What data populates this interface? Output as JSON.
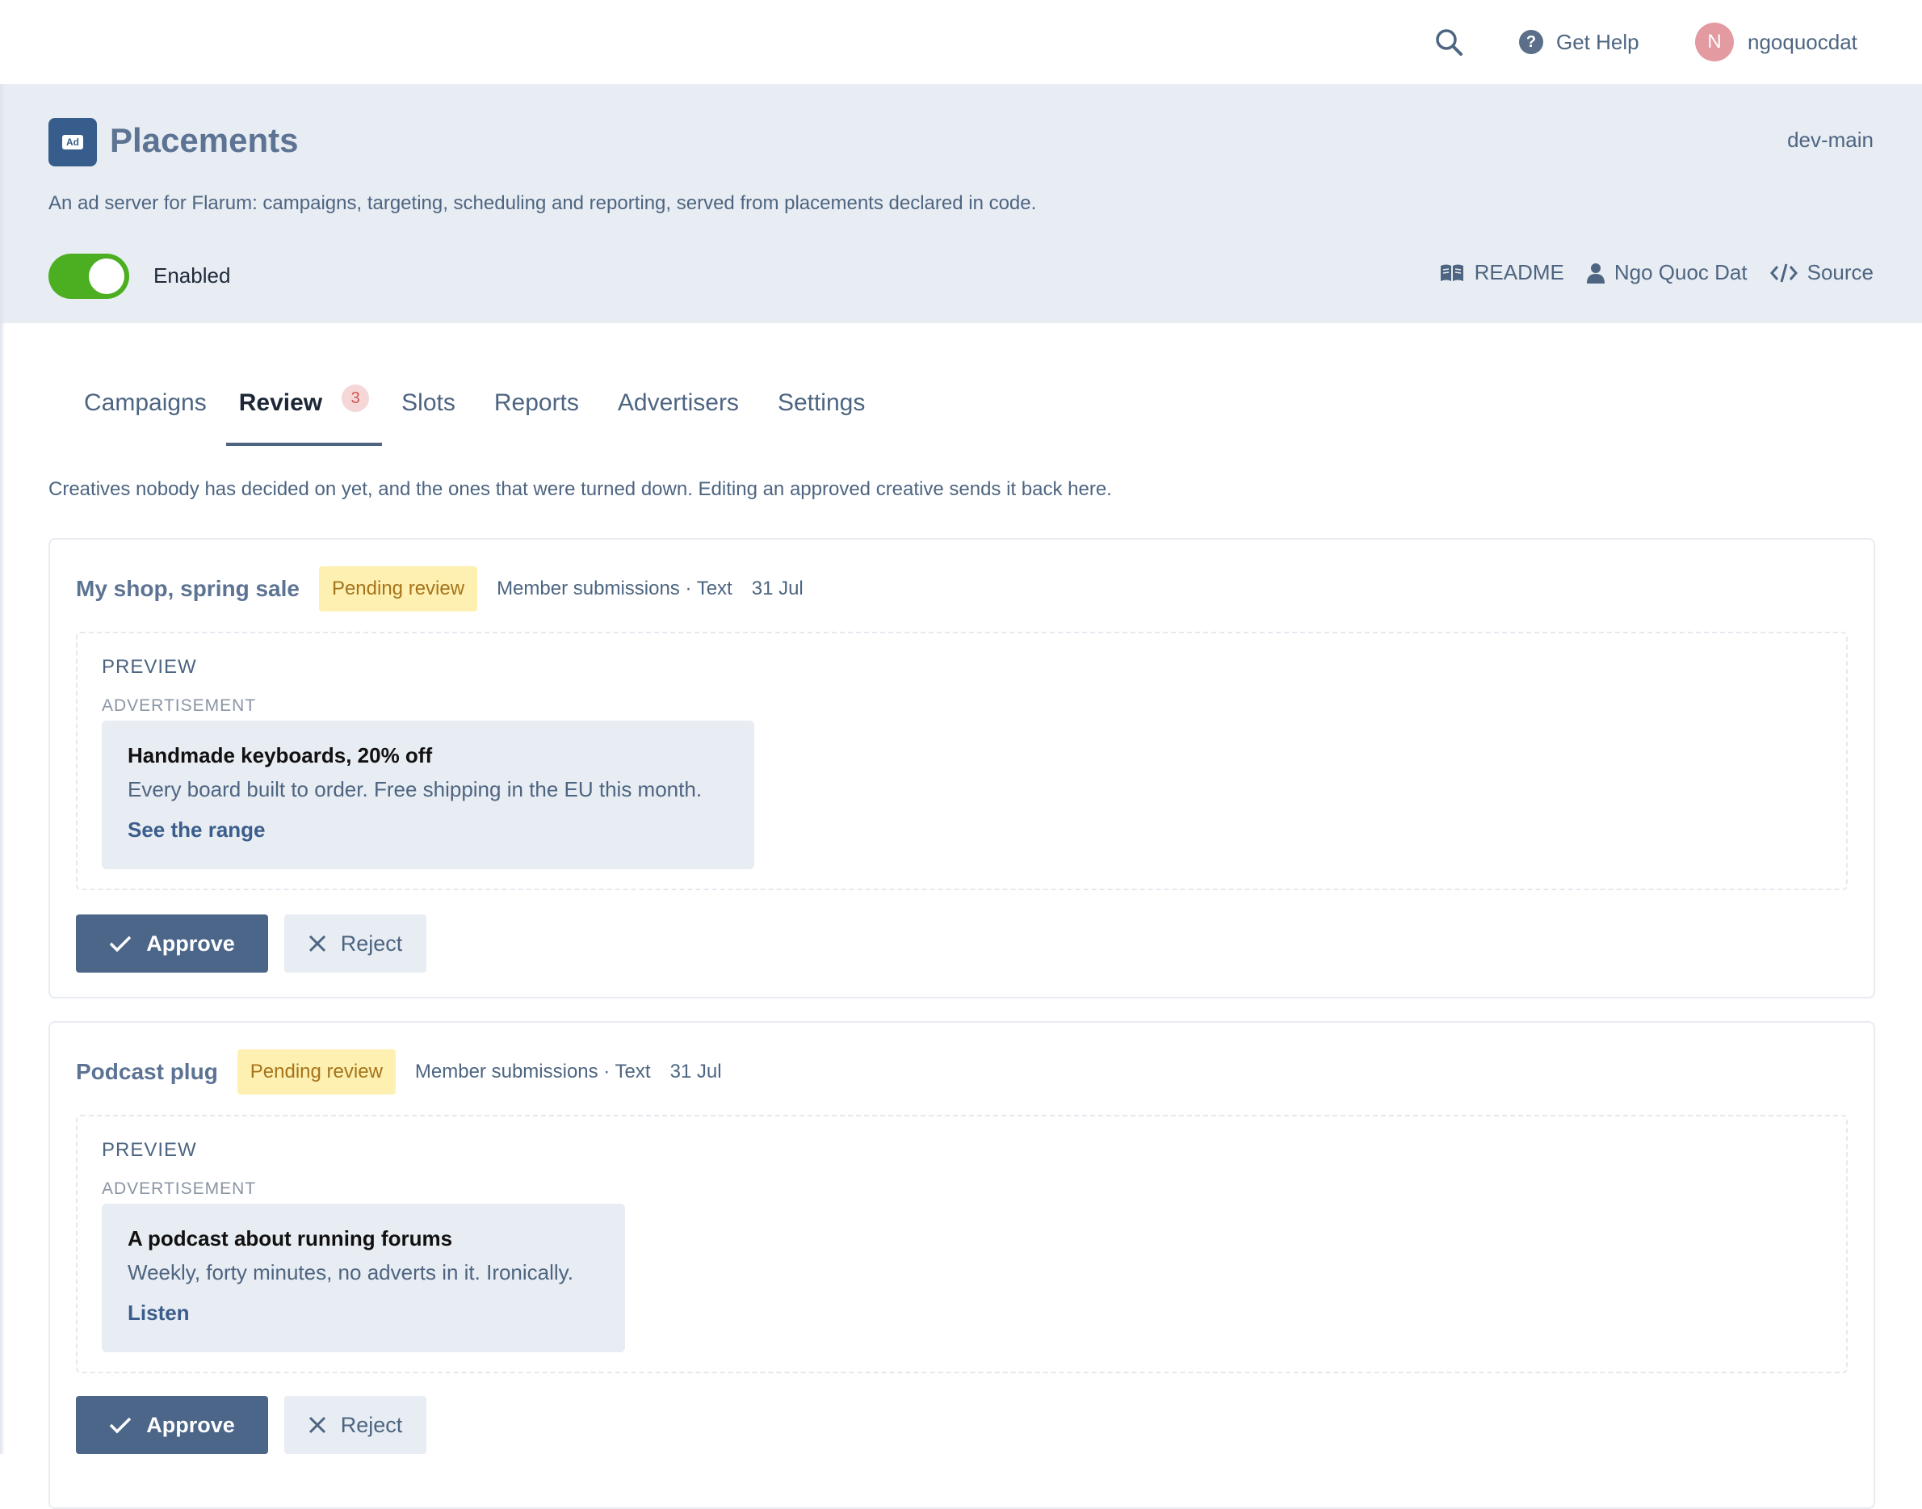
{
  "topbar": {
    "search_icon": "search-icon",
    "help_label": "Get Help",
    "help_icon": "question-circle-icon",
    "avatar_initial": "N",
    "username": "ngoquocdat"
  },
  "extension": {
    "title": "Placements",
    "icon_text": "Ad",
    "version": "dev-main",
    "description": "An ad server for Flarum: campaigns, targeting, scheduling and reporting, served from placements declared in code.",
    "enabled_label": "Enabled",
    "enabled": true,
    "links": {
      "readme": "README",
      "author": "Ngo Quoc Dat",
      "source": "Source"
    }
  },
  "tabs": [
    {
      "label": "Campaigns"
    },
    {
      "label": "Review",
      "badge": "3",
      "active": true
    },
    {
      "label": "Slots"
    },
    {
      "label": "Reports"
    },
    {
      "label": "Advertisers"
    },
    {
      "label": "Settings"
    }
  ],
  "intro": "Creatives nobody has decided on yet, and the ones that were turned down. Editing an approved creative sends it back here.",
  "cards": [
    {
      "title": "My shop, spring sale",
      "status": "Pending review",
      "meta": "Member submissions · Text",
      "date": "31 Jul",
      "preview_label": "PREVIEW",
      "advert_label": "ADVERTISEMENT",
      "ad": {
        "headline": "Handmade keyboards, 20% off",
        "body": "Every board built to order. Free shipping in the EU this month.",
        "link": "See the range"
      },
      "approve_label": "Approve",
      "reject_label": "Reject"
    },
    {
      "title": "Podcast plug",
      "status": "Pending review",
      "meta": "Member submissions · Text",
      "date": "31 Jul",
      "preview_label": "PREVIEW",
      "advert_label": "ADVERTISEMENT",
      "ad": {
        "headline": "A podcast about running forums",
        "body": "Weekly, forty minutes, no adverts in it. Ironically.",
        "link": "Listen"
      },
      "approve_label": "Approve",
      "reject_label": "Reject"
    }
  ],
  "colors": {
    "accent": "#4b6689",
    "toggle_on": "#4caf22",
    "status_bg": "#fdf0b0",
    "status_text": "#a6731b",
    "badge_bg": "#f6d7d7",
    "badge_text": "#d35555"
  }
}
